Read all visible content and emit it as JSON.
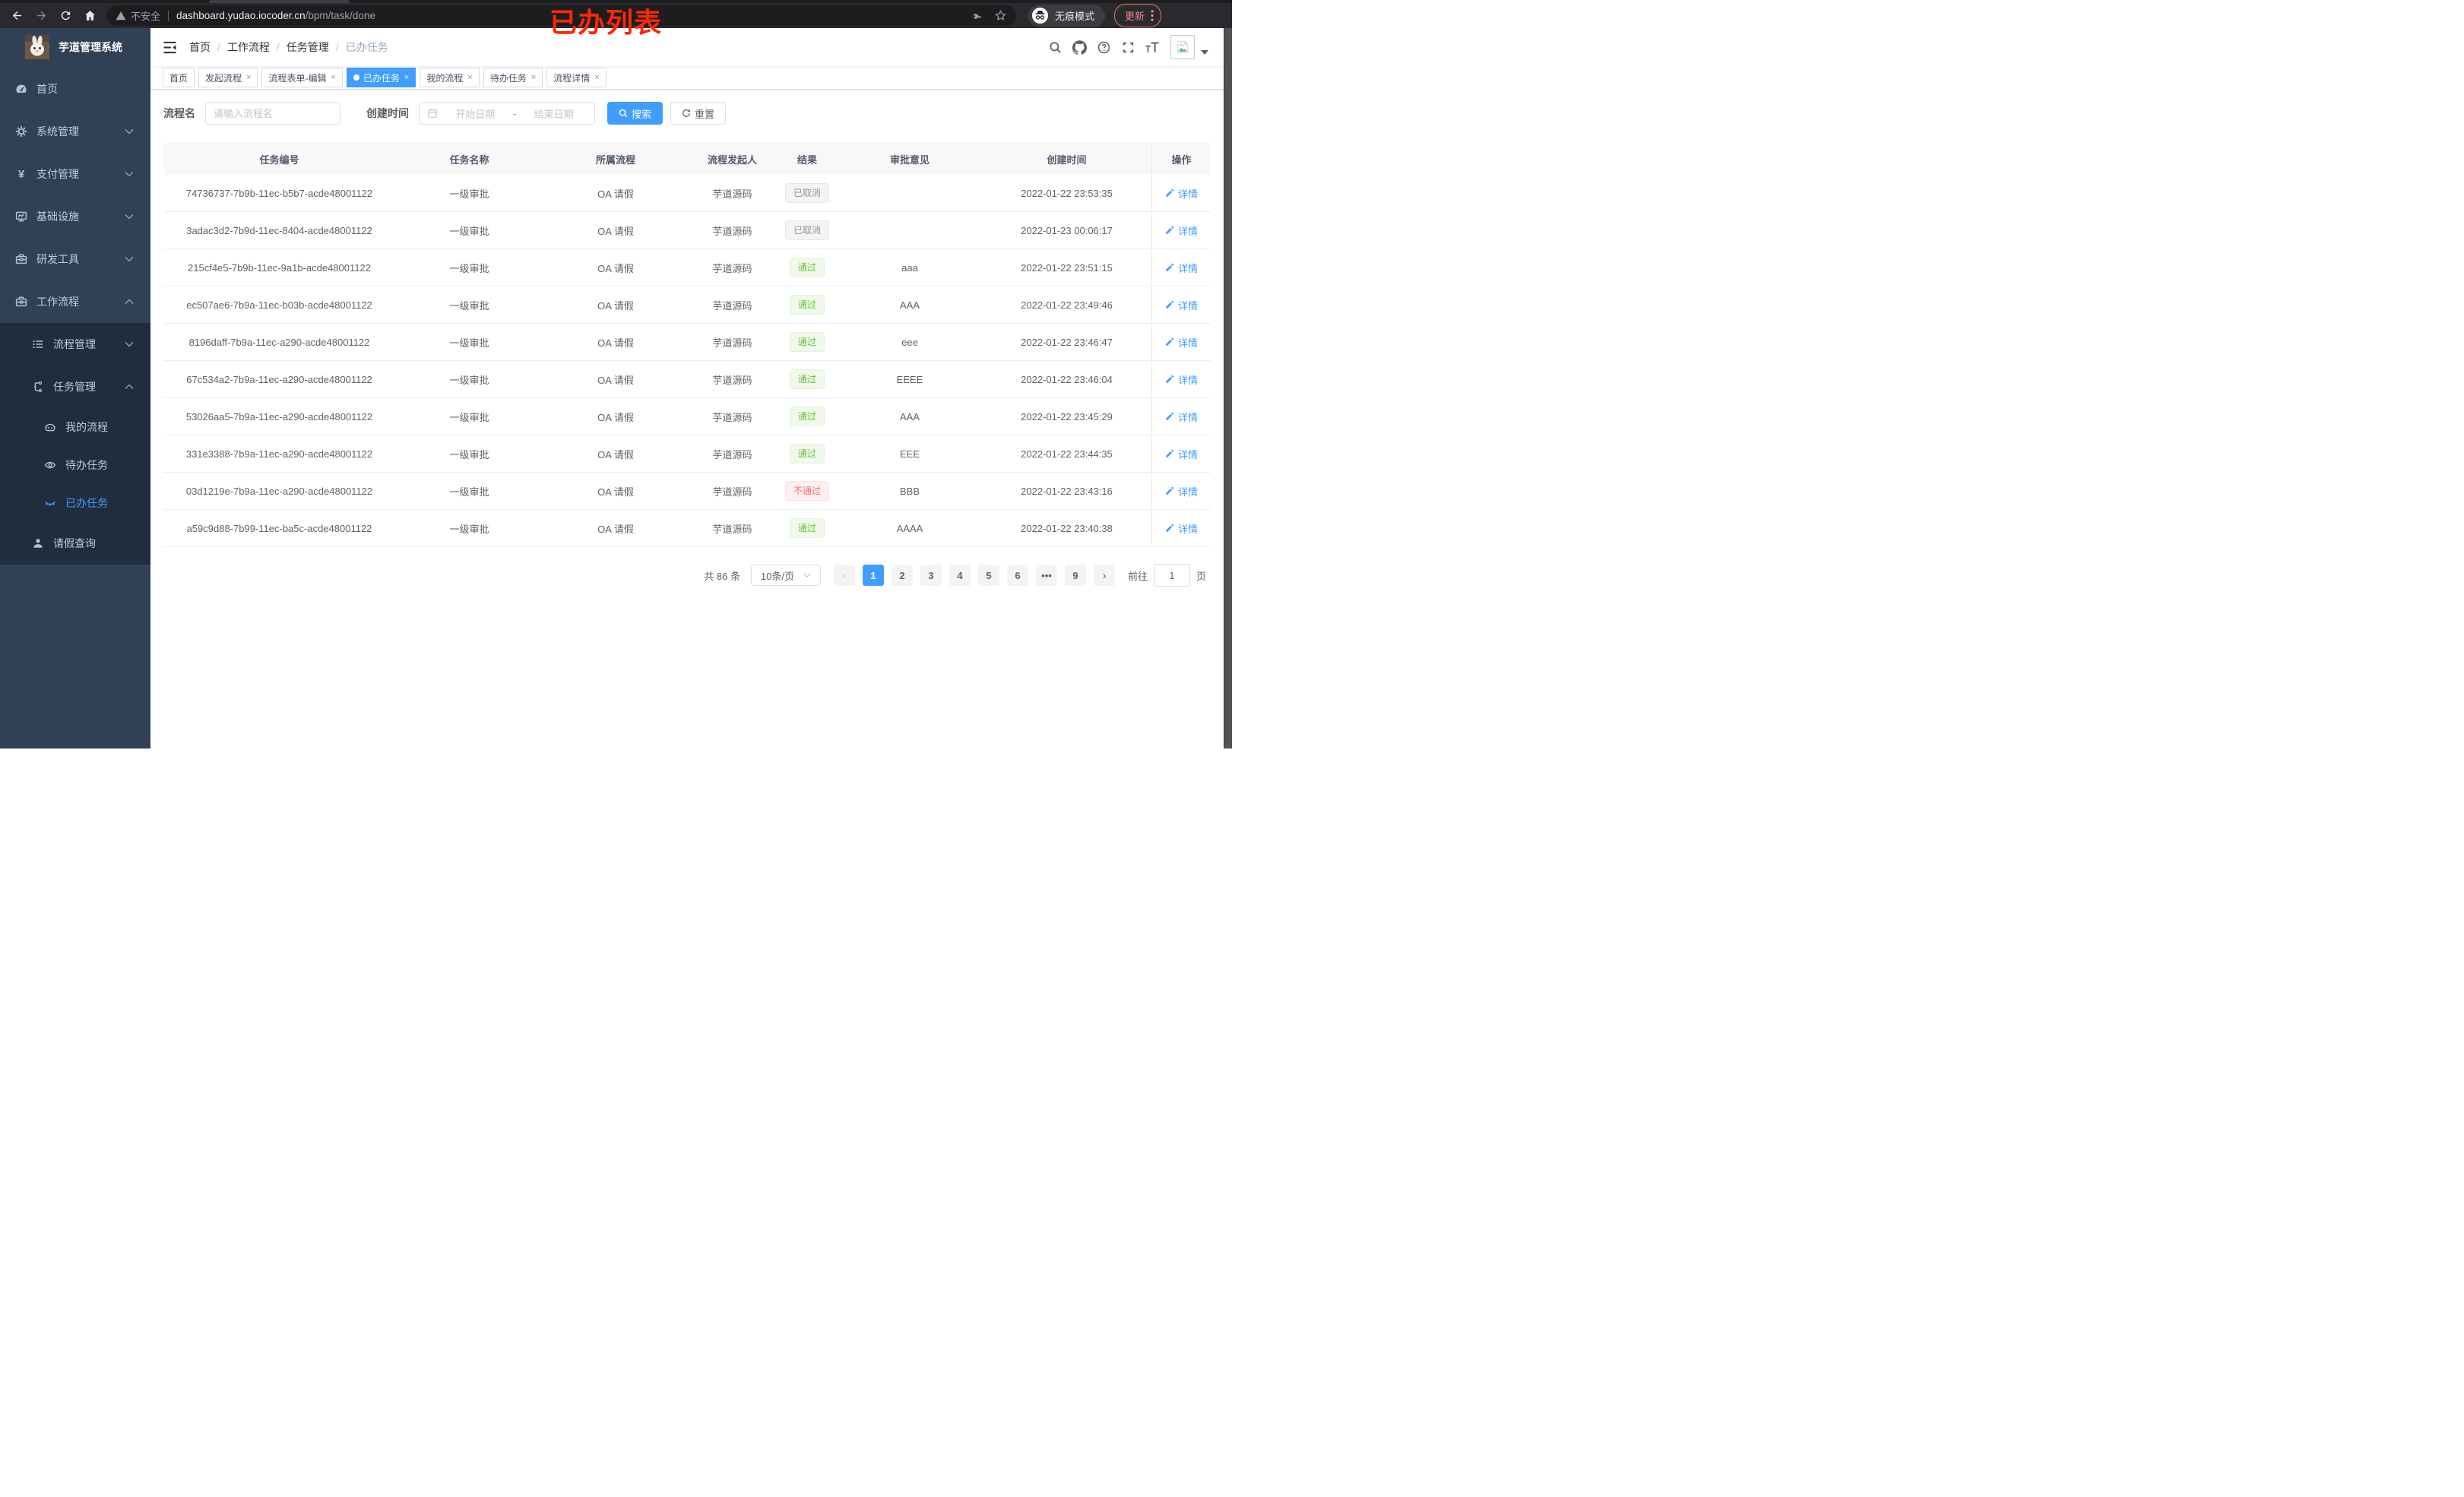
{
  "browser": {
    "security_label": "不安全",
    "url_host": "dashboard.yudao.iocoder.cn",
    "url_path": "/bpm/task/done",
    "incognito_label": "无痕模式",
    "update_label": "更新"
  },
  "annotation": {
    "text": "已办列表",
    "color": "#ff2600"
  },
  "sidebar": {
    "app_title": "芋道管理系统",
    "menu": [
      {
        "key": "home",
        "label": "首页",
        "icon": "dashboard-icon",
        "arrow": "",
        "level": 0,
        "group": false,
        "active": false
      },
      {
        "key": "system",
        "label": "系统管理",
        "icon": "gear-icon",
        "arrow": "down",
        "level": 0,
        "group": false,
        "active": false
      },
      {
        "key": "payment",
        "label": "支付管理",
        "icon": "yen-icon",
        "arrow": "down",
        "level": 0,
        "group": false,
        "active": false
      },
      {
        "key": "infrastructure",
        "label": "基础设施",
        "icon": "monitor-icon",
        "arrow": "down",
        "level": 0,
        "group": false,
        "active": false
      },
      {
        "key": "dev-tools",
        "label": "研发工具",
        "icon": "toolbox-icon",
        "arrow": "down",
        "level": 0,
        "group": false,
        "active": false
      },
      {
        "key": "workflow",
        "label": "工作流程",
        "icon": "briefcase-icon",
        "arrow": "up",
        "level": 0,
        "group": false,
        "active": false
      },
      {
        "key": "process-mgmt",
        "label": "流程管理",
        "icon": "list-icon",
        "arrow": "down",
        "level": 1,
        "group": true,
        "active": false
      },
      {
        "key": "task-mgmt",
        "label": "任务管理",
        "icon": "flow-icon",
        "arrow": "up",
        "level": 1,
        "group": true,
        "active": false
      },
      {
        "key": "my-process",
        "label": "我的流程",
        "icon": "robot-icon",
        "arrow": "",
        "level": 2,
        "group": true,
        "active": false
      },
      {
        "key": "todo-tasks",
        "label": "待办任务",
        "icon": "eye-icon",
        "arrow": "",
        "level": 2,
        "group": true,
        "active": false
      },
      {
        "key": "done-tasks",
        "label": "已办任务",
        "icon": "eye-closed-icon",
        "arrow": "",
        "level": 2,
        "group": true,
        "active": true
      },
      {
        "key": "leave-query",
        "label": "请假查询",
        "icon": "user-icon",
        "arrow": "",
        "level": 1,
        "group": true,
        "active": false
      }
    ]
  },
  "navbar": {
    "breadcrumb": [
      "首页",
      "工作流程",
      "任务管理",
      "已办任务"
    ]
  },
  "tabs": [
    {
      "key": "home",
      "label": "首页",
      "closable": false,
      "active": false
    },
    {
      "key": "start-process",
      "label": "发起流程",
      "closable": true,
      "active": false
    },
    {
      "key": "form-edit",
      "label": "流程表单-编辑",
      "closable": true,
      "active": false
    },
    {
      "key": "done-tasks",
      "label": "已办任务",
      "closable": true,
      "active": true
    },
    {
      "key": "my-process",
      "label": "我的流程",
      "closable": true,
      "active": false
    },
    {
      "key": "todo-tasks",
      "label": "待办任务",
      "closable": true,
      "active": false
    },
    {
      "key": "process-detail",
      "label": "流程详情",
      "closable": true,
      "active": false
    }
  ],
  "filters": {
    "name_label": "流程名",
    "name_placeholder": "请输入流程名",
    "time_label": "创建时间",
    "start_placeholder": "开始日期",
    "range_separator": "-",
    "end_placeholder": "结束日期",
    "search_label": "搜索",
    "reset_label": "重置"
  },
  "table": {
    "columns": [
      "任务编号",
      "任务名称",
      "所属流程",
      "流程发起人",
      "结果",
      "审批意见",
      "创建时间",
      "操作"
    ],
    "action_label": "详情",
    "rows": [
      {
        "id": "74736737-7b9b-11ec-b5b7-acde48001122",
        "name": "一级审批",
        "process": "OA 请假",
        "starter": "芋道源码",
        "result": "已取消",
        "result_type": "info",
        "comment": "",
        "created": "2022-01-22 23:53:35"
      },
      {
        "id": "3adac3d2-7b9d-11ec-8404-acde48001122",
        "name": "一级审批",
        "process": "OA 请假",
        "starter": "芋道源码",
        "result": "已取消",
        "result_type": "info",
        "comment": "",
        "created": "2022-01-23 00:06:17"
      },
      {
        "id": "215cf4e5-7b9b-11ec-9a1b-acde48001122",
        "name": "一级审批",
        "process": "OA 请假",
        "starter": "芋道源码",
        "result": "通过",
        "result_type": "success",
        "comment": "aaa",
        "created": "2022-01-22 23:51:15"
      },
      {
        "id": "ec507ae6-7b9a-11ec-b03b-acde48001122",
        "name": "一级审批",
        "process": "OA 请假",
        "starter": "芋道源码",
        "result": "通过",
        "result_type": "success",
        "comment": "AAA",
        "created": "2022-01-22 23:49:46"
      },
      {
        "id": "8196daff-7b9a-11ec-a290-acde48001122",
        "name": "一级审批",
        "process": "OA 请假",
        "starter": "芋道源码",
        "result": "通过",
        "result_type": "success",
        "comment": "eee",
        "created": "2022-01-22 23:46:47"
      },
      {
        "id": "67c534a2-7b9a-11ec-a290-acde48001122",
        "name": "一级审批",
        "process": "OA 请假",
        "starter": "芋道源码",
        "result": "通过",
        "result_type": "success",
        "comment": "EEEE",
        "created": "2022-01-22 23:46:04"
      },
      {
        "id": "53026aa5-7b9a-11ec-a290-acde48001122",
        "name": "一级审批",
        "process": "OA 请假",
        "starter": "芋道源码",
        "result": "通过",
        "result_type": "success",
        "comment": "AAA",
        "created": "2022-01-22 23:45:29"
      },
      {
        "id": "331e3388-7b9a-11ec-a290-acde48001122",
        "name": "一级审批",
        "process": "OA 请假",
        "starter": "芋道源码",
        "result": "通过",
        "result_type": "success",
        "comment": "EEE",
        "created": "2022-01-22 23:44:35"
      },
      {
        "id": "03d1219e-7b9a-11ec-a290-acde48001122",
        "name": "一级审批",
        "process": "OA 请假",
        "starter": "芋道源码",
        "result": "不通过",
        "result_type": "danger",
        "comment": "BBB",
        "created": "2022-01-22 23:43:16"
      },
      {
        "id": "a59c9d88-7b99-11ec-ba5c-acde48001122",
        "name": "一级审批",
        "process": "OA 请假",
        "starter": "芋道源码",
        "result": "通过",
        "result_type": "success",
        "comment": "AAAA",
        "created": "2022-01-22 23:40:38"
      }
    ]
  },
  "pagination": {
    "total_label": "共 86 条",
    "page_size_label": "10条/页",
    "pages": [
      "1",
      "2",
      "3",
      "4",
      "5",
      "6",
      "•••",
      "9"
    ],
    "active_page": "1",
    "prev_label": "‹",
    "next_label": "›",
    "goto_label": "前往",
    "goto_value": "1",
    "page_unit": "页"
  },
  "colors": {
    "primary": "#409eff",
    "success_text": "#67c23a",
    "danger_text": "#f56c6c",
    "info_text": "#909399",
    "sidebar_bg": "#304156",
    "submenu_bg": "#1f2d3d"
  }
}
